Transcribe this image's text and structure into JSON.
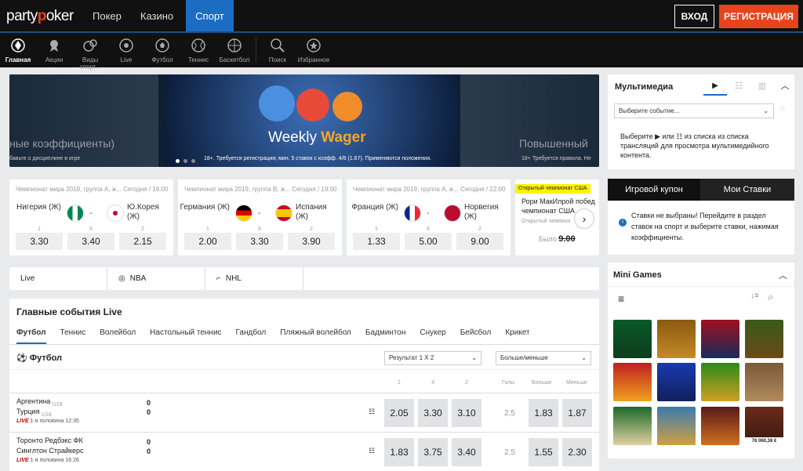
{
  "header": {
    "logo": "partypoker",
    "nav": [
      "Покер",
      "Казино",
      "Спорт"
    ],
    "login": "ВХОД",
    "register": "РЕГИСТРАЦИЯ"
  },
  "subnav": [
    "Главная",
    "Акции",
    "Виды спорт...",
    "Live",
    "Футбол",
    "Теннис",
    "Баскетбол",
    "Поиск",
    "Избранное"
  ],
  "banner": {
    "left_big": "ные коэффициенты)",
    "left_small": "бавьте о дисциплине в игре",
    "title_a": "Weekly",
    "title_b": "Wager",
    "terms": "18+. Требуется регистрация; мин. 5 ставок с коэфф. 4/6 (1.67). Применяются положения.",
    "right_big": "Повышенный",
    "right_small": "18+ Требуется правила. Не"
  },
  "matches": [
    {
      "head": "Чемпионат мира 2019, группа А, ж... Сегодня / 16:00",
      "home": "Нигерия (Ж)",
      "away": "Ю.Корея (Ж)",
      "l": [
        "1",
        "X",
        "2"
      ],
      "o": [
        "3.30",
        "3.40",
        "2.15"
      ]
    },
    {
      "head": "Чемпионат мира 2019, группа В, ж... Сегодня / 19:00",
      "home": "Германия (Ж)",
      "away": "Испания (Ж)",
      "l": [
        "1",
        "X",
        "2"
      ],
      "o": [
        "2.00",
        "3.30",
        "3.90"
      ]
    },
    {
      "head": "Чемпионат мира 2019, группа А, ж... Сегодня / 22:00",
      "home": "Франция (Ж)",
      "away": "Норвегия (Ж)",
      "l": [
        "1",
        "X",
        "2"
      ],
      "o": [
        "1.33",
        "5.00",
        "9.00"
      ]
    }
  ],
  "special": {
    "head": "Открытый чемпионат США",
    "text": "Рори МакИлрой побед чемпионат США",
    "sub": "Открытый чемпион",
    "was": "Было",
    "was_odds": "9.00"
  },
  "tabs": [
    "Live",
    "NBA",
    "NHL"
  ],
  "live": {
    "title": "Главные события Live",
    "sports": [
      "Футбол",
      "Теннис",
      "Волейбол",
      "Настольный теннис",
      "Гандбол",
      "Пляжный волейбол",
      "Бадминтон",
      "Снукер",
      "Бейсбол",
      "Крикет"
    ],
    "section": "Футбол",
    "select1": "Результат 1 X 2",
    "select2": "Больше/меньше",
    "cols": [
      "1",
      "X",
      "2",
      "Голы",
      "Больше",
      "Меньше"
    ],
    "rows": [
      {
        "t1": "Аргентина",
        "t1s": "U18",
        "t2": "Турция",
        "t2s": "U18",
        "s1": "0",
        "s2": "0",
        "meta_live": "LIVE",
        "meta": "1-я половина 12:35",
        "o": [
          "2.05",
          "3.30",
          "3.10"
        ],
        "goals": "2,5",
        "ou": [
          "1.83",
          "1.87"
        ]
      },
      {
        "t1": "Торонто Редбэкс ФК",
        "t1s": "",
        "t2": "Синглтон Страйкерс",
        "t2s": "",
        "s1": "0",
        "s2": "0",
        "meta_live": "LIVE",
        "meta": "1-я половина 16:26",
        "o": [
          "1.83",
          "3.75",
          "3.40"
        ],
        "goals": "2,5",
        "ou": [
          "1.55",
          "2.30"
        ]
      }
    ]
  },
  "multimedia": {
    "title": "Мультимедиа",
    "select": "Выберите событие...",
    "text": "Выберите ▶ или ☷ из списка из списка трансляций для просмотра мультимедийного контента."
  },
  "coupon": {
    "tab1": "Игровой купон",
    "tab2": "Мои Ставки",
    "text": "Ставки не выбраны! Перейдите в раздел ставок на спорт и выберите ставки, нажимая коэффициенты."
  },
  "minigames": {
    "title": "Mini Games",
    "jackpot": "76 060,38 €"
  }
}
